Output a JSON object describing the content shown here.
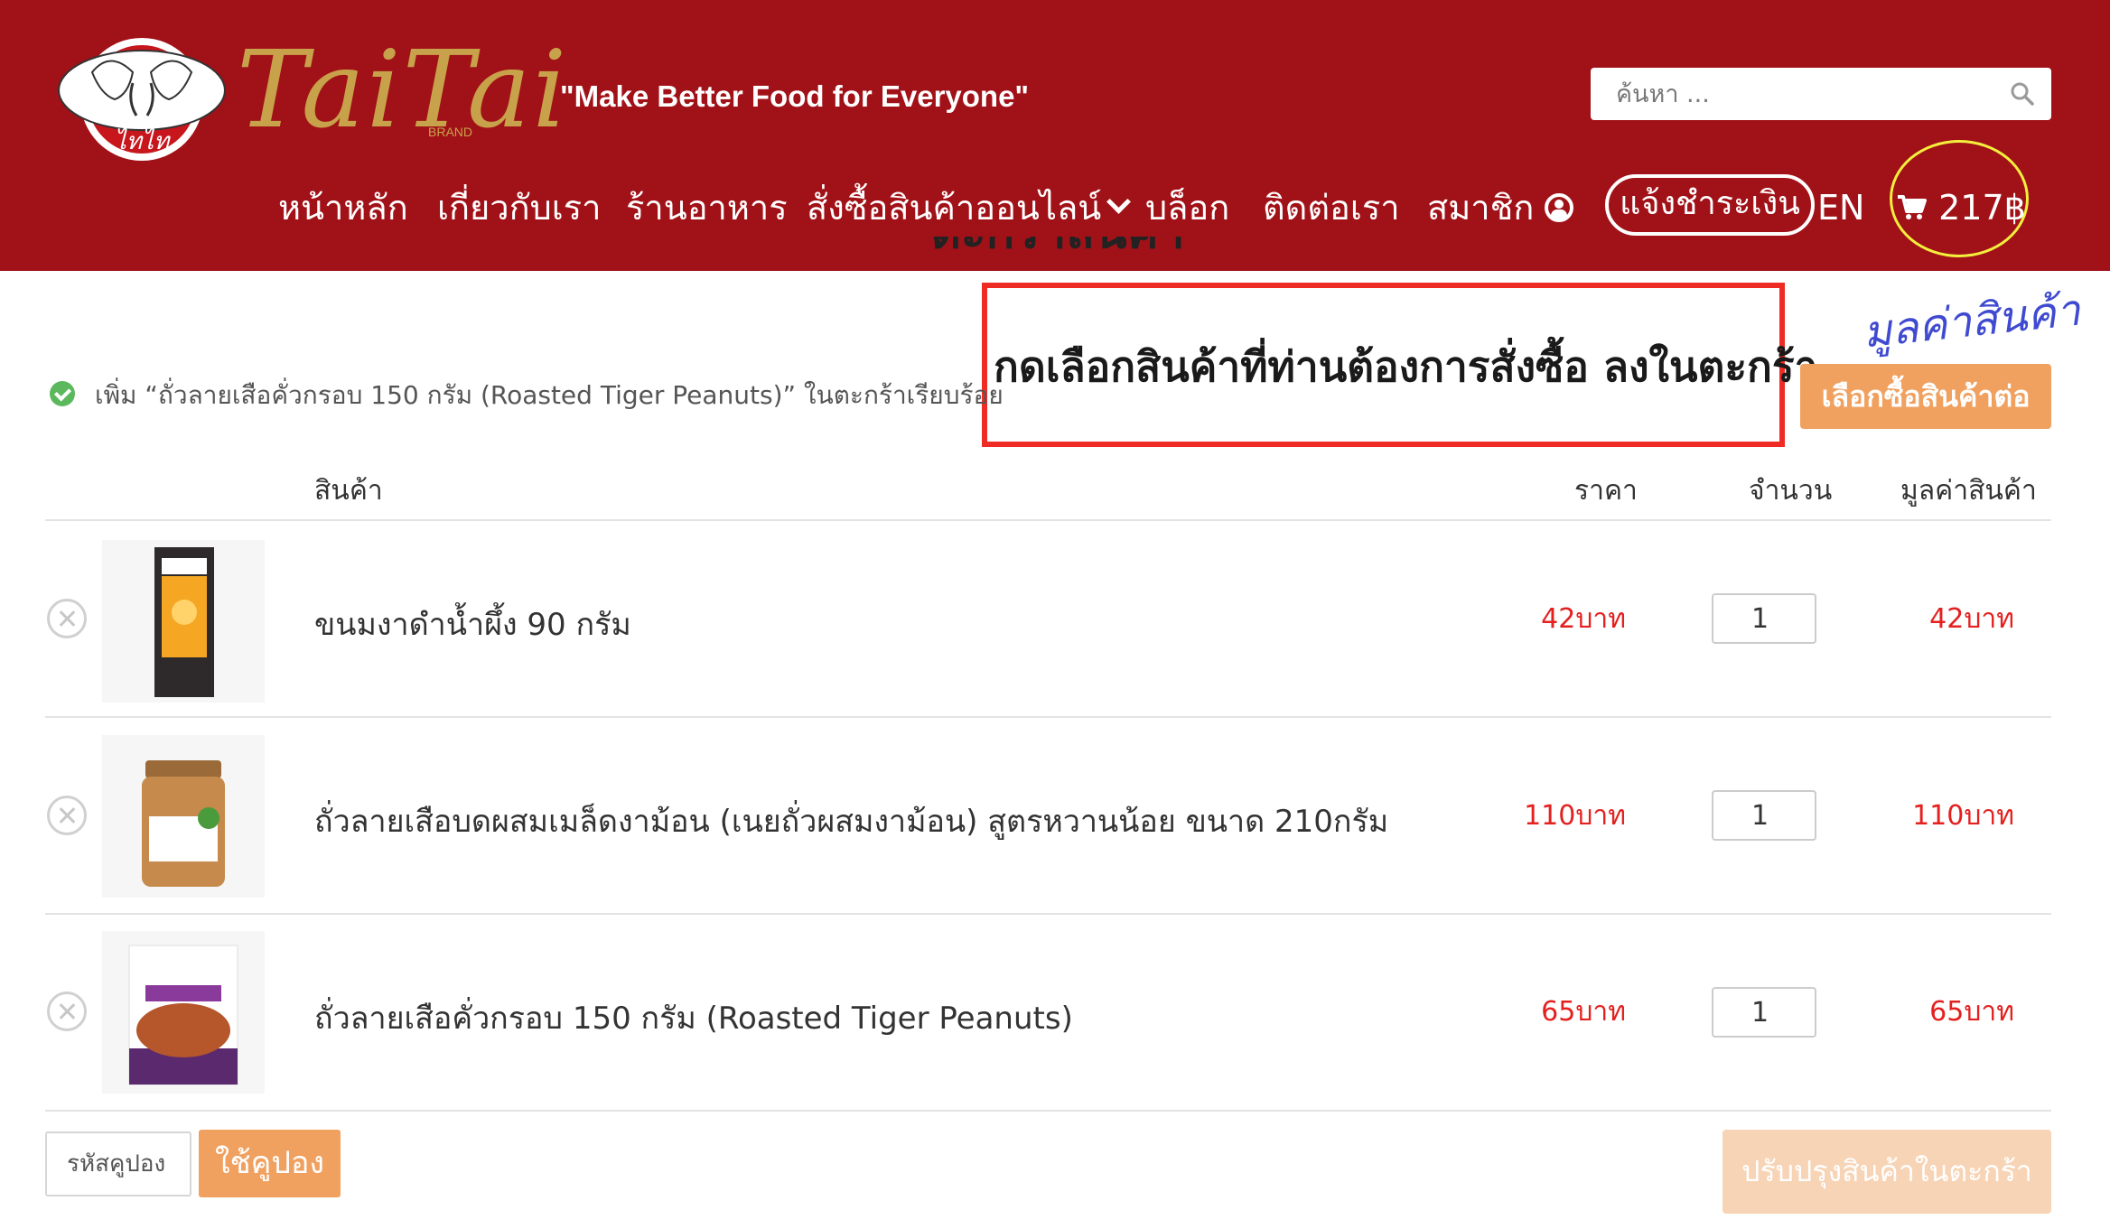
{
  "header": {
    "logo_text": "TaiTai",
    "logo_badge_text": "ไทไท",
    "logo_brand_small": "BRAND",
    "slogan": "\"Make Better Food for Everyone\"",
    "background_color": "#a11218",
    "search": {
      "placeholder": "ค้นหา ..."
    },
    "nav": [
      {
        "label": "หน้าหลัก"
      },
      {
        "label": "เกี่ยวกับเรา"
      },
      {
        "label": "ร้านอาหาร"
      },
      {
        "label": "สั่งซื้อสินค้าออนไลน์"
      },
      {
        "label": "บล็อก"
      },
      {
        "label": "ติดต่อเรา"
      },
      {
        "label": "สมาชิก"
      }
    ],
    "pay_button": "แจ้งชำระเงิน",
    "lang": "EN",
    "cart_total": "217฿"
  },
  "page": {
    "heading": "ตะกร้าสินค้า"
  },
  "annotations": {
    "boxed_text": "กดเลือกสินค้าที่ท่านต้องการสั่งซื้อ ลงในตะกร้า",
    "handwritten": "มูลค่าสินค้า",
    "box_color": "#ee2b24",
    "circle_color": "#f3ef3d"
  },
  "notice": {
    "message": "เพิ่ม “ถั่วลายเสือคั่วกรอบ 150 กรัม (Roasted Tiger Peanuts)” ในตะกร้าเรียบร้อย"
  },
  "continue_button": "เลือกซื้อสินค้าต่อ",
  "table": {
    "headers": {
      "product": "สินค้า",
      "price": "ราคา",
      "qty": "จำนวน",
      "subtotal": "มูลค่าสินค้า"
    },
    "rows": [
      {
        "name": "ขนมงาดำน้ำผึ้ง 90 กรัม",
        "price": "42บาท",
        "qty": "1",
        "subtotal": "42บาท"
      },
      {
        "name": "ถั่วลายเสือบดผสมเมล็ดงาม้อน (เนยถั่วผสมงาม้อน) สูตรหวานน้อย ขนาด 210กรัม",
        "price": "110บาท",
        "qty": "1",
        "subtotal": "110บาท"
      },
      {
        "name": "ถั่วลายเสือคั่วกรอบ 150 กรัม (Roasted Tiger Peanuts)",
        "price": "65บาท",
        "qty": "1",
        "subtotal": "65บาท"
      }
    ]
  },
  "coupon": {
    "placeholder": "รหัสคูปอง",
    "button": "ใช้คูปอง"
  },
  "update_button": "ปรับปรุงสินค้าในตะกร้า",
  "colors": {
    "accent_orange": "#f0a160",
    "price_red": "#e3211f",
    "success_green": "#5cb85c"
  }
}
